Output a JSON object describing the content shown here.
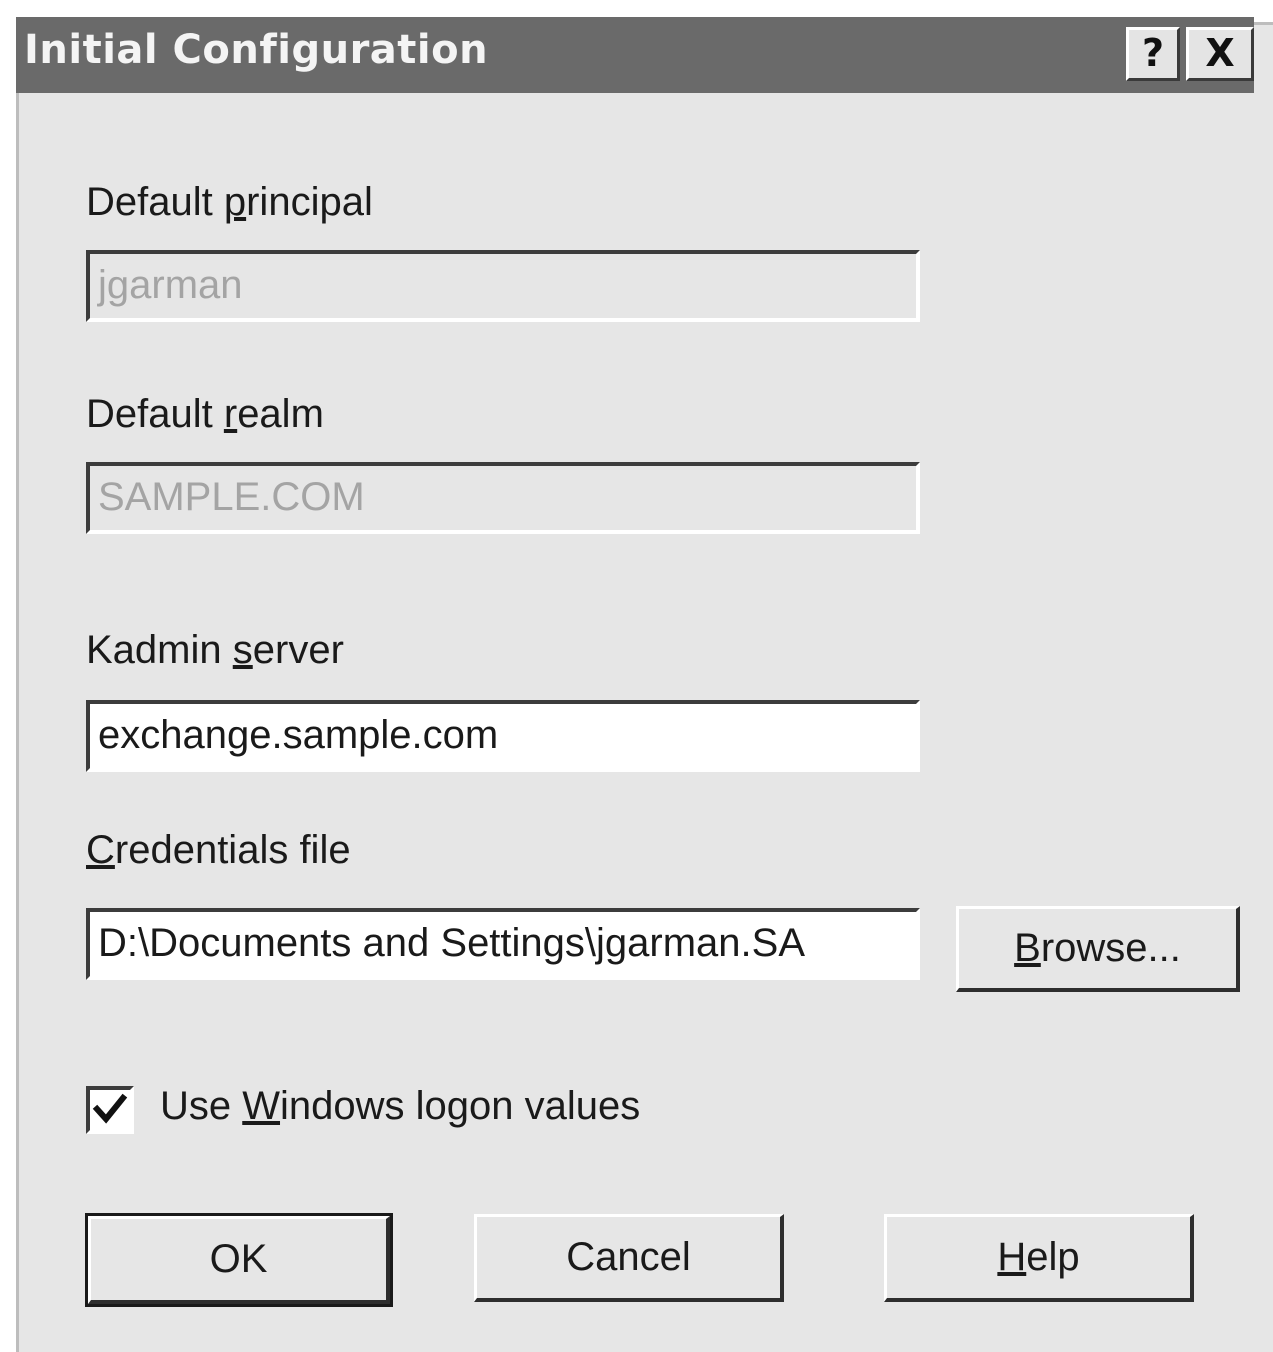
{
  "dialog": {
    "title": "Initial Configuration",
    "help_button": "?",
    "close_button": "X"
  },
  "principal": {
    "label_pre": "Default ",
    "label_key": "p",
    "label_post": "rincipal",
    "value": "jgarman"
  },
  "realm": {
    "label_pre": "Default ",
    "label_key": "r",
    "label_post": "ealm",
    "value": "SAMPLE.COM"
  },
  "kadmin": {
    "label_pre": "Kadmin ",
    "label_key": "s",
    "label_post": "erver",
    "value": "exchange.sample.com"
  },
  "credentials": {
    "label_pre": "",
    "label_key": "C",
    "label_post": "redentials file",
    "value": "D:\\Documents and Settings\\jgarman.SA",
    "browse_key": "B",
    "browse_post": "rowse..."
  },
  "windows_logon": {
    "checked": true,
    "label_pre": "Use ",
    "label_key": "W",
    "label_post": "indows logon values"
  },
  "buttons": {
    "ok": "OK",
    "cancel": "Cancel",
    "help_key": "H",
    "help_post": "elp"
  }
}
